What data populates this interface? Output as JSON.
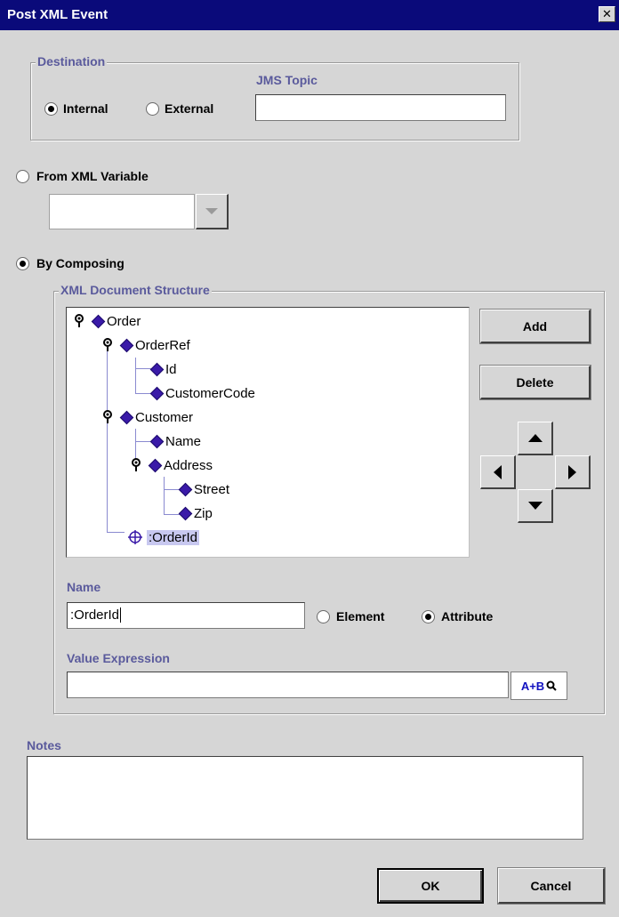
{
  "window": {
    "title": "Post XML Event",
    "close_glyph": "✕"
  },
  "destination": {
    "legend": "Destination",
    "internal_label": "Internal",
    "external_label": "External",
    "selected": "Internal",
    "jms_topic_label": "JMS Topic",
    "jms_topic_value": ""
  },
  "from_xml_variable": {
    "label": "From XML Variable",
    "selected": false,
    "dropdown_value": ""
  },
  "by_composing": {
    "label": "By Composing",
    "selected": true
  },
  "xml_structure": {
    "legend": "XML Document Structure",
    "tree": [
      {
        "label": "Order",
        "type": "element",
        "expanded": true
      },
      {
        "label": "OrderRef",
        "type": "element",
        "expanded": true
      },
      {
        "label": "Id",
        "type": "element"
      },
      {
        "label": "CustomerCode",
        "type": "element"
      },
      {
        "label": "Customer",
        "type": "element",
        "expanded": true
      },
      {
        "label": "Name",
        "type": "element"
      },
      {
        "label": "Address",
        "type": "element",
        "expanded": true
      },
      {
        "label": "Street",
        "type": "element"
      },
      {
        "label": "Zip",
        "type": "element"
      },
      {
        "label": ":OrderId",
        "type": "attribute",
        "selected": true
      }
    ],
    "add_label": "Add",
    "delete_label": "Delete"
  },
  "name": {
    "label": "Name",
    "value": ":OrderId",
    "element_label": "Element",
    "attribute_label": "Attribute",
    "selected": "Attribute"
  },
  "value_expression": {
    "label": "Value Expression",
    "value": "",
    "builder_label": "A+B"
  },
  "notes": {
    "label": "Notes",
    "value": ""
  },
  "footer": {
    "ok_label": "OK",
    "cancel_label": "Cancel"
  }
}
